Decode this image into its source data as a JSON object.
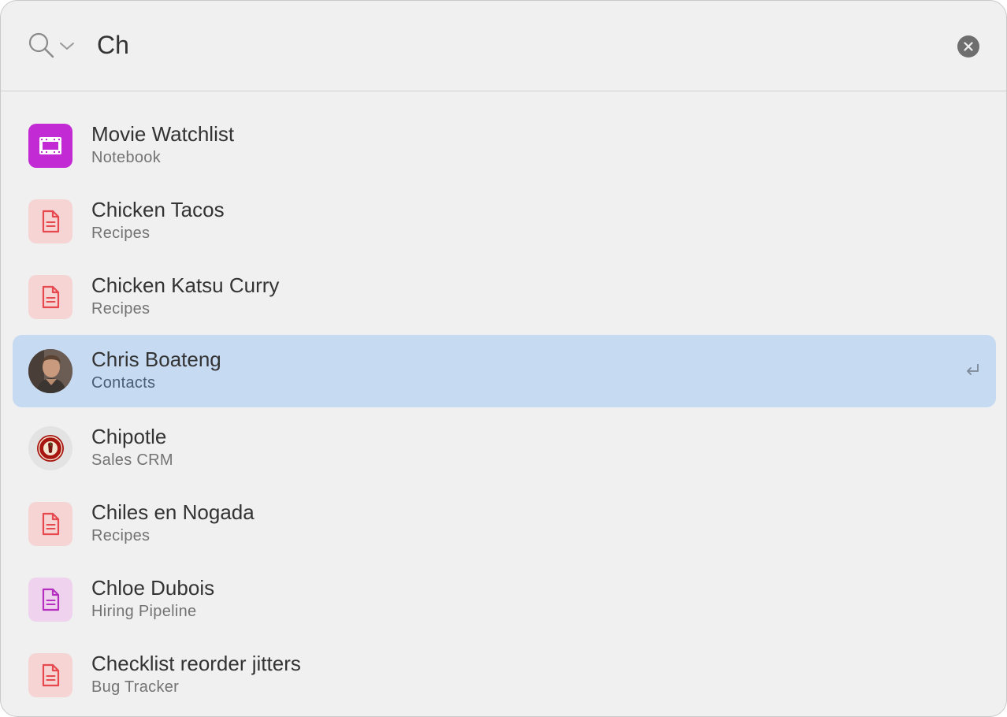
{
  "search": {
    "value": "Ch",
    "scope_icon": "magnifying-glass-icon",
    "scope_dropdown_icon": "chevron-down-icon",
    "clear_icon": "clear-circle-icon",
    "caret_color": "#1a7cf5"
  },
  "results": [
    {
      "title": "Movie Watchlist",
      "subtitle": "Notebook",
      "icon": "film-notebook-icon",
      "icon_color": "#c22bd3"
    },
    {
      "title": "Chicken Tacos",
      "subtitle": "Recipes",
      "icon": "document-icon",
      "icon_color": "#e5484d"
    },
    {
      "title": "Chicken Katsu Curry",
      "subtitle": "Recipes",
      "icon": "document-icon",
      "icon_color": "#e5484d"
    },
    {
      "title": "Chris Boateng",
      "subtitle": "Contacts",
      "icon": "contact-avatar",
      "selected": true,
      "action_icon": "return-key-icon"
    },
    {
      "title": "Chipotle",
      "subtitle": "Sales CRM",
      "icon": "chipotle-logo",
      "logo_color": "#a81612"
    },
    {
      "title": "Chiles en Nogada",
      "subtitle": "Recipes",
      "icon": "document-icon",
      "icon_color": "#e5484d"
    },
    {
      "title": "Chloe Dubois",
      "subtitle": "Hiring Pipeline",
      "icon": "document-icon",
      "icon_color": "#b530c0"
    },
    {
      "title": "Checklist reorder jitters",
      "subtitle": "Bug Tracker",
      "icon": "document-icon",
      "icon_color": "#e5484d"
    }
  ],
  "colors": {
    "selected_row": "#c6daf2",
    "background": "#f0f0f0"
  }
}
